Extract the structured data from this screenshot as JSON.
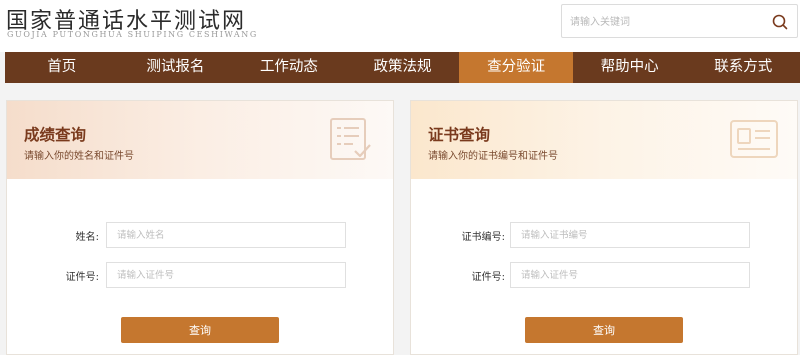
{
  "site": {
    "title_cn": "国家普通话水平测试网",
    "title_en": "GUOJIA PUTONGHUA SHUIPING CESHIWANG"
  },
  "search": {
    "placeholder": "请输入关键词",
    "icon": "search-icon"
  },
  "nav": {
    "items": [
      {
        "label": "首页"
      },
      {
        "label": "测试报名"
      },
      {
        "label": "工作动态"
      },
      {
        "label": "政策法规"
      },
      {
        "label": "查分验证",
        "active": true
      },
      {
        "label": "帮助中心"
      },
      {
        "label": "联系方式"
      }
    ]
  },
  "score_query": {
    "title": "成绩查询",
    "subtitle": "请输入你的姓名和证件号",
    "icon": "document-list-icon",
    "fields": [
      {
        "label": "姓名:",
        "placeholder": "请输入姓名",
        "value": ""
      },
      {
        "label": "证件号:",
        "placeholder": "请输入证件号",
        "value": ""
      }
    ],
    "submit_label": "查询"
  },
  "certificate_query": {
    "title": "证书查询",
    "subtitle": "请输入你的证书编号和证件号",
    "icon": "id-card-icon",
    "fields": [
      {
        "label": "证书编号:",
        "placeholder": "请输入证书编号",
        "value": ""
      },
      {
        "label": "证件号:",
        "placeholder": "请输入证件号",
        "value": ""
      }
    ],
    "submit_label": "查询"
  },
  "colors": {
    "nav_bg": "#6a3a1e",
    "accent": "#c5772f",
    "title_text": "#7a3a1d"
  }
}
